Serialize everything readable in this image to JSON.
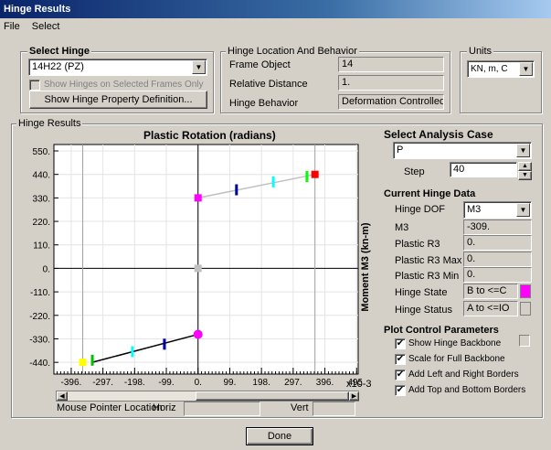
{
  "window": {
    "title": "Hinge Results"
  },
  "menu": [
    "File",
    "Select"
  ],
  "select_hinge": {
    "group_label": "Select Hinge",
    "hinge_value": "14H22 (PZ)",
    "show_selected_label": "Show Hinges on Selected Frames Only",
    "show_property_button": "Show Hinge Property Definition..."
  },
  "hinge_location": {
    "group_label": "Hinge Location And Behavior",
    "frame_object_label": "Frame Object",
    "frame_object_value": "14",
    "relative_distance_label": "Relative Distance",
    "relative_distance_value": "1.",
    "hinge_behavior_label": "Hinge Behavior",
    "hinge_behavior_value": "Deformation Controlled"
  },
  "units": {
    "group_label": "Units",
    "value": "KN, m, C"
  },
  "hinge_results": {
    "group_label": "Hinge Results"
  },
  "chart_data": {
    "type": "line",
    "title": "Plastic Rotation  (radians)",
    "ylabel": "Moment M3  (kn-m)",
    "x_multiplier": "x10-3",
    "x_tick_labels": [
      "-396.",
      "-297.",
      "-198.",
      "-99.",
      "0.",
      "99.",
      "198.",
      "297.",
      "396.",
      "495."
    ],
    "y_tick_labels": [
      "550.",
      "440.",
      "330.",
      "220.",
      "110.",
      "0.",
      "-110.",
      "-220.",
      "-330.",
      "-440."
    ],
    "xlim": [
      -450,
      500
    ],
    "ylim": [
      -495,
      580
    ],
    "grid": true,
    "series": [
      {
        "x": [
          -330,
          0
        ],
        "y": [
          -440,
          -309
        ],
        "color": "#000000"
      },
      {
        "x": [
          0,
          365
        ],
        "y": [
          330,
          440
        ],
        "color": "#c0c0c0"
      }
    ],
    "markers": [
      {
        "x": -360,
        "y": -440,
        "color": "#ffff00",
        "shape": "square"
      },
      {
        "x": -330,
        "y": -430,
        "color": "#00c000",
        "shape": "bar"
      },
      {
        "x": -205,
        "y": -390,
        "color": "#00ffff",
        "shape": "bar"
      },
      {
        "x": -105,
        "y": -355,
        "color": "#0000a0",
        "shape": "bar"
      },
      {
        "x": 0,
        "y": -309,
        "color": "#ff00ff",
        "shape": "dot"
      },
      {
        "x": 0,
        "y": 0,
        "color": "#c0c0c0",
        "shape": "square"
      },
      {
        "x": 0,
        "y": 330,
        "color": "#ff00ff",
        "shape": "square"
      },
      {
        "x": 120,
        "y": 368,
        "color": "#0000a0",
        "shape": "bar"
      },
      {
        "x": 235,
        "y": 405,
        "color": "#00ffff",
        "shape": "bar"
      },
      {
        "x": 340,
        "y": 430,
        "color": "#00ff00",
        "shape": "bar"
      },
      {
        "x": 365,
        "y": 440,
        "color": "#ff0000",
        "shape": "square"
      }
    ],
    "guides_x": [
      -360,
      365
    ]
  },
  "mouse_pointer": {
    "label": "Mouse Pointer Location",
    "horiz_label": "Horiz",
    "horiz_value": "",
    "vert_label": "Vert",
    "vert_value": ""
  },
  "analysis_case": {
    "label": "Select Analysis Case",
    "value": "P",
    "step_label": "Step",
    "step_value": "40"
  },
  "current_hinge": {
    "label": "Current Hinge Data",
    "hinge_dof_label": "Hinge DOF",
    "hinge_dof_value": "M3",
    "m3_label": "M3",
    "m3_value": "-309.",
    "plastic_r3_label": "Plastic R3",
    "plastic_r3_value": "0.",
    "plastic_r3_max_label": "Plastic R3 Max",
    "plastic_r3_max_value": "0.",
    "plastic_r3_min_label": "Plastic R3 Min",
    "plastic_r3_min_value": "0.",
    "hinge_state_label": "Hinge State",
    "hinge_state_value": "B to <=C",
    "hinge_state_color": "#ff00ff",
    "hinge_status_label": "Hinge Status",
    "hinge_status_value": "A to <=IO"
  },
  "plot_control": {
    "label": "Plot Control Parameters",
    "show_backbone_label": "Show Hinge Backbone",
    "show_backbone_checked": true,
    "scale_full_label": "Scale for Full Backbone",
    "scale_full_checked": true,
    "left_right_label": "Add Left and Right Borders",
    "left_right_checked": true,
    "top_bottom_label": "Add Top and Bottom Borders",
    "top_bottom_checked": true
  },
  "done_button": "Done"
}
